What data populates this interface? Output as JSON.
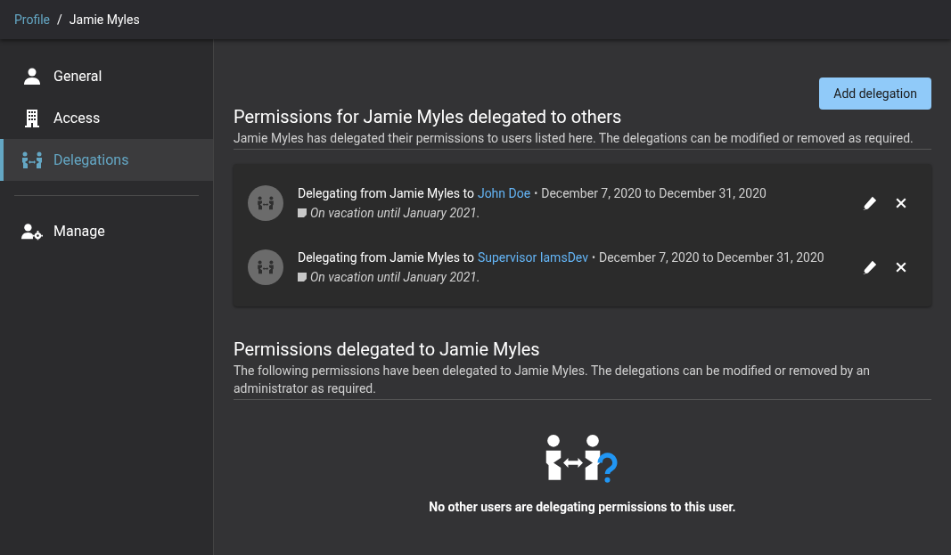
{
  "breadcrumb": {
    "parent": "Profile",
    "separator": "/",
    "current": "Jamie Myles"
  },
  "sidebar": {
    "items": [
      {
        "label": "General",
        "kind": "person",
        "selected": false
      },
      {
        "label": "Access",
        "kind": "building",
        "selected": false
      },
      {
        "label": "Delegations",
        "kind": "delegation",
        "selected": true
      }
    ],
    "secondary_items": [
      {
        "label": "Manage",
        "kind": "manage",
        "selected": false
      }
    ]
  },
  "add_button": "Add delegation",
  "outgoing": {
    "title": "Permissions for Jamie Myles delegated to others",
    "description": "Jamie Myles has delegated their permissions to users listed here. The delegations can be modified or removed as required.",
    "rows": [
      {
        "prefix": "Delegating from Jamie Myles to",
        "delegate": "John Doe",
        "separator": "•",
        "dates": "December 7, 2020 to December 31, 2020",
        "note": "On vacation until January 2021."
      },
      {
        "prefix": "Delegating from Jamie Myles to",
        "delegate": "Supervisor IamsDev",
        "separator": "•",
        "dates": "December 7, 2020 to December 31, 2020",
        "note": "On vacation until January 2021."
      }
    ]
  },
  "incoming": {
    "title": "Permissions delegated to Jamie Myles",
    "description": "The following permissions have been delegated to Jamie Myles. The delegations can be modified or removed by an administrator as required.",
    "empty_message": "No other users are delegating permissions to this user."
  }
}
